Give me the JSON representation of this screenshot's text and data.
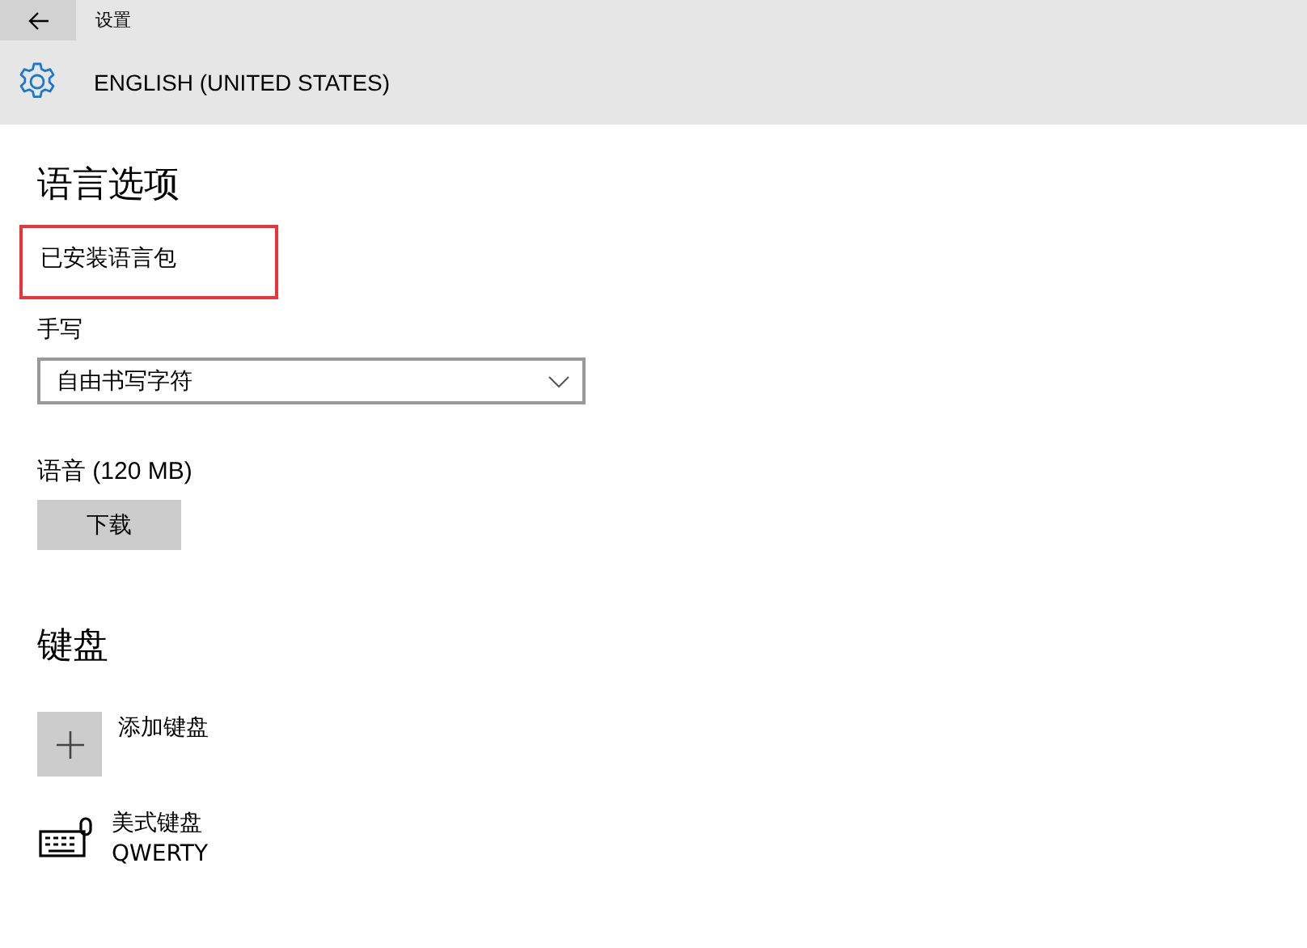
{
  "window": {
    "title": "设置"
  },
  "header": {
    "title": "ENGLISH (UNITED STATES)"
  },
  "language_options": {
    "heading": "语言选项",
    "installed_status": {
      "label": "已安装语言包",
      "highlighted": true
    },
    "handwriting": {
      "label": "手写",
      "value": "自由书写字符"
    },
    "speech": {
      "label": "语音 (120 MB)",
      "button": "下载"
    }
  },
  "keyboard": {
    "heading": "键盘",
    "add_label": "添加键盘",
    "keyboards": [
      {
        "name": "美式键盘",
        "layout": "QWERTY"
      }
    ]
  }
}
